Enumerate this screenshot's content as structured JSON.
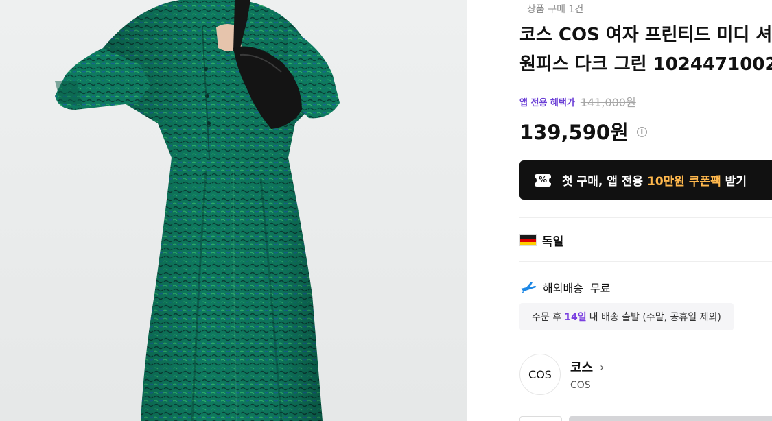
{
  "product": {
    "purchase_count": "상품 구매 1건",
    "title_line1": "코스 COS 여자 프린티드 미디 셔",
    "title_line2": "원피스 다크 그린 1024471002",
    "benefit_label": "앱 전용 혜택가",
    "original_price": "141,000원",
    "sale_price": "139,590원",
    "info_icon": "i"
  },
  "coupon": {
    "icon": "coupon-icon",
    "icon_glyph": "%",
    "text_before": "첫 구매, 앱 전용 ",
    "text_highlight": "10만원 쿠폰팩",
    "text_after": " 받기",
    "highlight_color": "#ffb84d"
  },
  "origin": {
    "flag": "germany-flag-icon",
    "country": "독일"
  },
  "shipping": {
    "icon": "airplane-icon",
    "label": "해외배송",
    "fee": "무료",
    "dispatch_prefix": "주문 후",
    "dispatch_days": "14일",
    "dispatch_suffix": "내 배송 출발 (주말, 공휴일 제외)"
  },
  "brand": {
    "logo_text": "COS",
    "name_kr": "코스",
    "name_en": "COS",
    "chevron": "›"
  },
  "colors": {
    "accent_purple": "#6b3fd6",
    "dress_green": "#0f7a62",
    "button_black": "#111111"
  }
}
